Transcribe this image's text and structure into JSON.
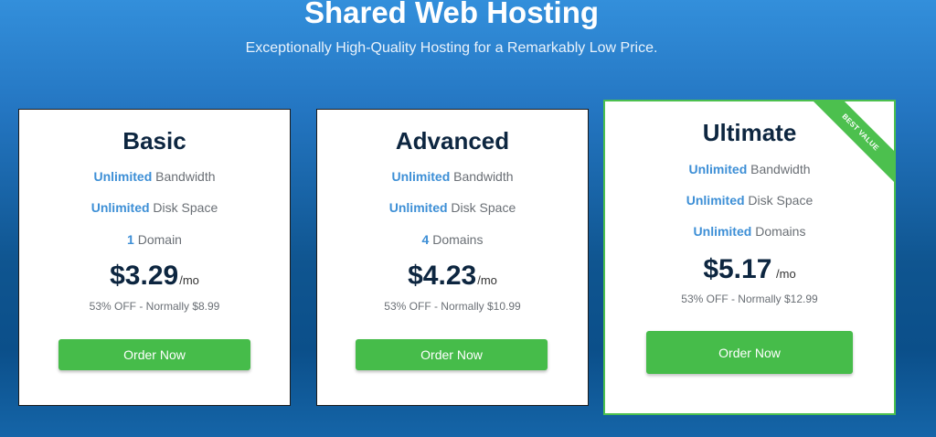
{
  "hero": {
    "title": "Shared Web Hosting",
    "subtitle": "Exceptionally High-Quality Hosting for a Remarkably Low Price."
  },
  "plans": [
    {
      "name": "Basic",
      "features": [
        {
          "highlight": "Unlimited",
          "text": " Bandwidth"
        },
        {
          "highlight": "Unlimited",
          "text": " Disk Space"
        },
        {
          "highlight": "1",
          "text": " Domain"
        }
      ],
      "price": "$3.29",
      "period": "/mo",
      "discount": "53% OFF - Normally $8.99",
      "button": "Order Now"
    },
    {
      "name": "Advanced",
      "features": [
        {
          "highlight": "Unlimited",
          "text": " Bandwidth"
        },
        {
          "highlight": "Unlimited",
          "text": " Disk Space"
        },
        {
          "highlight": "4",
          "text": " Domains"
        }
      ],
      "price": "$4.23",
      "period": "/mo",
      "discount": "53% OFF - Normally $10.99",
      "button": "Order Now"
    },
    {
      "name": "Ultimate",
      "badge": "BEST VALUE",
      "features": [
        {
          "highlight": "Unlimited",
          "text": " Bandwidth"
        },
        {
          "highlight": "Unlimited",
          "text": " Disk Space"
        },
        {
          "highlight": "Unlimited",
          "text": " Domains"
        }
      ],
      "price": "$5.17",
      "period": " /mo",
      "discount": "53% OFF - Normally $12.99",
      "button": "Order Now"
    }
  ],
  "colors": {
    "accent_blue": "#3d8fd6",
    "button_green": "#46bc4a",
    "title_navy": "#0d2640"
  }
}
